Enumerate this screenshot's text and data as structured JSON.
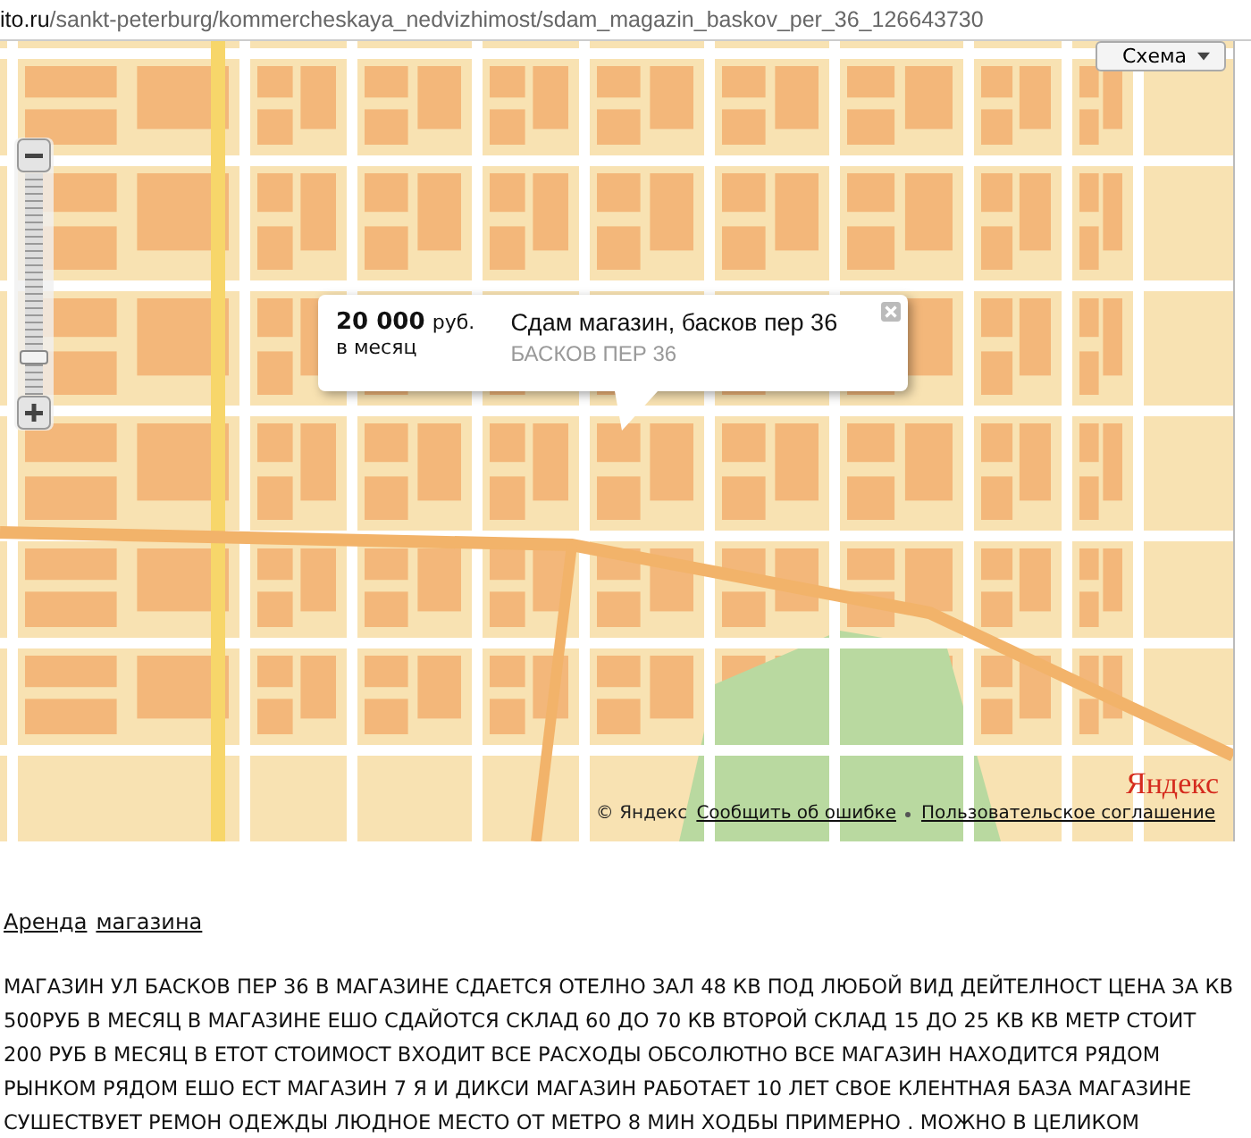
{
  "address_bar": {
    "domain": "ito.ru",
    "path": "/sankt-peterburg/kommercheskaya_nedvizhimost/sdam_magazin_baskov_per_36_126643730"
  },
  "map": {
    "type_button": "Схема",
    "popup": {
      "price": "20 000",
      "currency": "руб.",
      "period": "в месяц",
      "title": "Сдам магазин, басков пер 36",
      "address": "БАСКОВ ПЕР 36"
    },
    "zoom": {
      "level": 0.15
    },
    "copyright": "© Яндекс",
    "links": [
      "Сообщить об ошибке",
      "Пользовательское соглашение"
    ],
    "logo": "Яндекс"
  },
  "breadcrumbs": [
    "Аренда",
    "магазина"
  ],
  "description": "МАГАЗИН УЛ БАСКОВ ПЕР 36 В МАГАЗИНЕ СДАЕТСЯ ОТЕЛНО ЗАЛ 48 КВ ПОД ЛЮБОЙ ВИД ДЕЙТЕЛНОСТ ЦЕНА ЗА КВ 500РУБ В МЕСЯЦ В МАГАЗИНЕ ЕШО СДАЙОТСЯ СКЛАД 60 ДО 70 КВ ВТОРОЙ СКЛАД 15 ДО 25 КВ КВ МЕТР СТОИТ 200 РУБ В МЕСЯЦ В ЕТОТ СТОИМОСТ ВХОДИТ ВСЕ РАСХОДЫ ОБСОЛЮТНО ВСЕ МАГАЗИН НАХОДИТСЯ РЯДОМ РЫНКОМ РЯДОМ ЕШО ЕСТ МАГАЗИН 7 Я И ДИКСИ МАГАЗИН РАБОТАЕТ 10 ЛЕТ СВОЕ КЛЕНТНАЯ БАЗА МАГАЗИНЕ СУШЕСТВУЕТ РЕМОН ОДЕЖДЫ ЛЮДНОЕ МЕСТО ОТ МЕТРО 8 МИН ХОДБЫ ПРИМЕРНО . МОЖНО В ЦЕЛИКОМ"
}
